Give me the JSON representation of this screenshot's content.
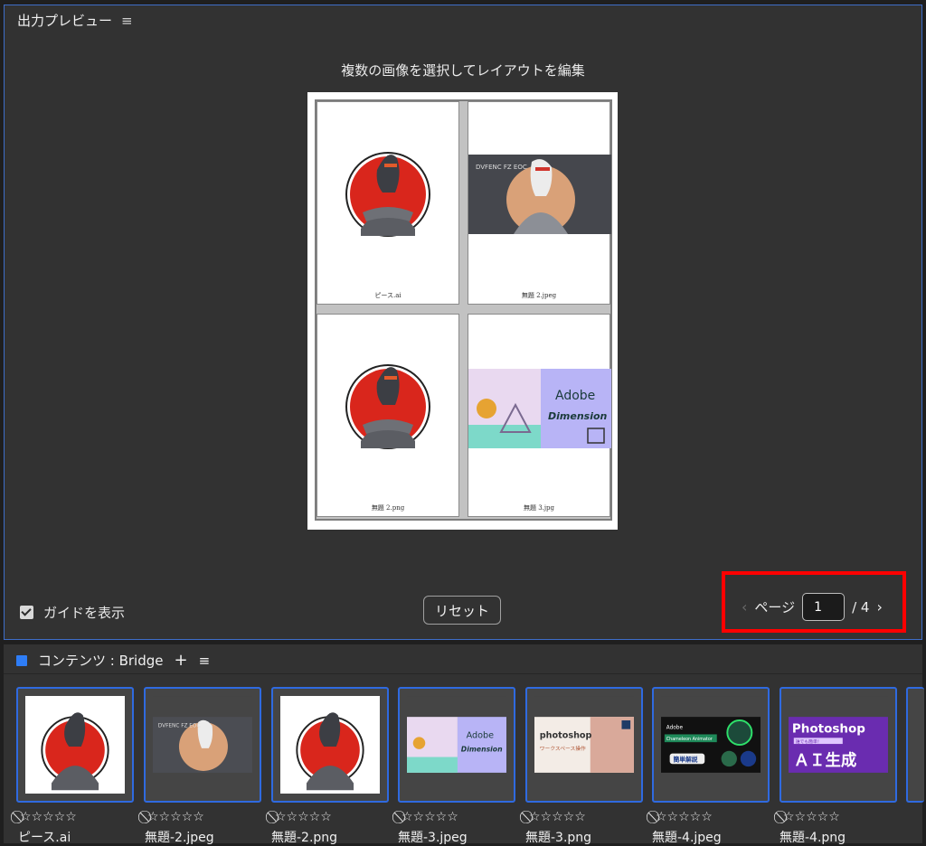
{
  "preview": {
    "title": "出力プレビュー",
    "menu_icon": "≡",
    "heading": "複数の画像を選択してレイアウトを編集",
    "cells": [
      {
        "label": "ピース.ai"
      },
      {
        "label": "無題 2.jpeg"
      },
      {
        "label": "無題 2.png"
      },
      {
        "label": "無題 3.jpg"
      }
    ],
    "show_guides_label": "ガイドを表示",
    "show_guides_checked": true,
    "reset_label": "リセット",
    "pager": {
      "prev_icon": "‹",
      "page_label": "ページ",
      "current_page": "1",
      "total": "/ 4",
      "next_icon": "›"
    }
  },
  "content": {
    "title": "コンテンツ : Bridge",
    "add_icon": "+",
    "menu_icon": "≡",
    "items": [
      {
        "name": "ピース.ai",
        "rating": "⃠☆☆☆☆☆"
      },
      {
        "name": "無題-2.jpeg",
        "rating": "⃠☆☆☆☆☆"
      },
      {
        "name": "無題-2.png",
        "rating": "⃠☆☆☆☆☆"
      },
      {
        "name": "無題-3.jpeg",
        "rating": "⃠☆☆☆☆☆"
      },
      {
        "name": "無題-3.png",
        "rating": "⃠☆☆☆☆☆"
      },
      {
        "name": "無題-4.jpeg",
        "rating": "⃠☆☆☆☆☆"
      },
      {
        "name": "無題-4.png",
        "rating": "⃠☆☆☆☆☆"
      }
    ],
    "thumb_texts": {
      "adobe": "Adobe",
      "dimension": "Dimension",
      "photoshop_lower": "photoshop",
      "ps_workspace": "ワークスペース操作",
      "chameleon_brand": "Adobe",
      "chameleon_title": "Chameleon Animator",
      "chameleon_badge": "簡単解説",
      "photoshop": "Photoshop",
      "ps_sub": "誰でも簡単！",
      "ai_gen": "ＡＩ生成",
      "banner_text": "DVFENC  FZ EOC"
    }
  },
  "colors": {
    "panel_bg": "#323232",
    "panel_border": "#3e6ec9",
    "highlight": "#ff0000",
    "accent_blue": "#2e7df6"
  }
}
